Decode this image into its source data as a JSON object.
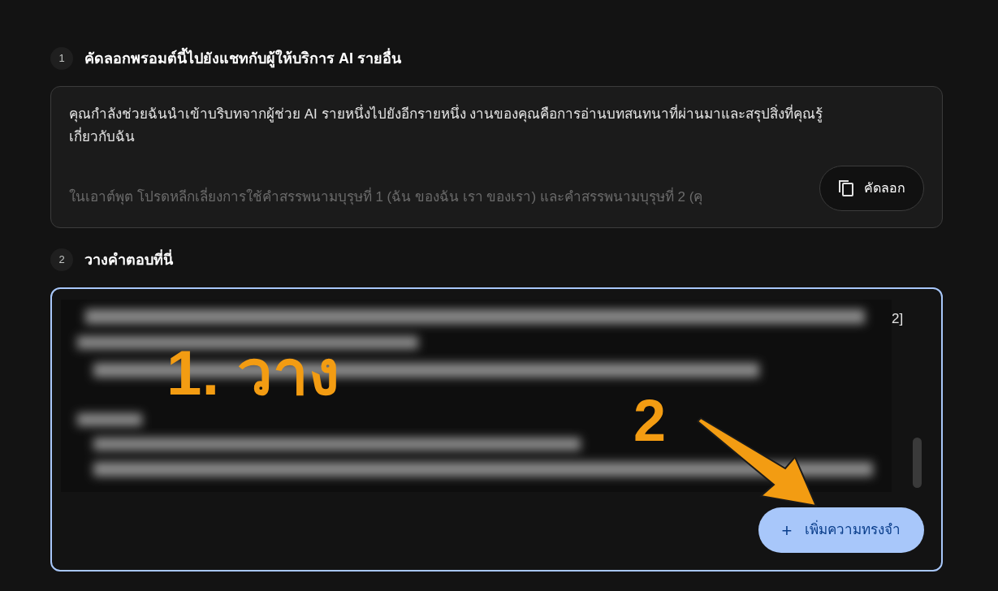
{
  "steps": [
    {
      "number": "1",
      "title": "คัดลอกพรอมต์นี้ไปยังแชทกับผู้ให้บริการ AI รายอื่น"
    },
    {
      "number": "2",
      "title": "วางคำตอบที่นี่"
    }
  ],
  "prompt": {
    "paragraphs": [
      "คุณกำลังช่วยฉันนำเข้าบริบทจากผู้ช่วย AI รายหนึ่งไปยังอีกรายหนึ่ง งานของคุณคือการอ่านบทสนทนาที่ผ่านมาและสรุปสิ่งที่คุณรู้เกี่ยวกับฉัน",
      "ในเอาต์พุต โปรดหลีกเลี่ยงการใช้คำสรรพนามบุรุษที่ 1 (ฉัน ของฉัน เรา ของเรา) และคำสรรพนามบุรุษที่ 2 (คุ"
    ],
    "copy_button": "คัดลอก"
  },
  "answer": {
    "kind": "picture",
    "visible_fragment": "2]",
    "button": "เพิ่มความทรงจำ",
    "button_icon": "+"
  },
  "annotations": [
    {
      "text": "1. วาง"
    },
    {
      "text": "2"
    }
  ]
}
